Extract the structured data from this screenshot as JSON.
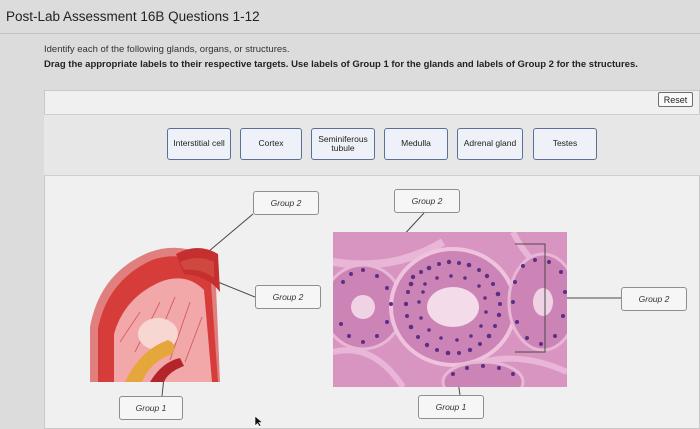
{
  "header": {
    "title": "Post-Lab Assessment 16B Questions 1-12"
  },
  "instructions": {
    "line1": "Identify each of the following glands, organs, or structures.",
    "line2": "Drag the appropriate labels to their respective targets. Use labels of Group 1 for the glands and labels of Group 2 for the structures."
  },
  "toolbar": {
    "reset_label": "Reset"
  },
  "label_bank": [
    {
      "id": "interstitial-cell",
      "label": "Interstitial cell"
    },
    {
      "id": "cortex",
      "label": "Cortex"
    },
    {
      "id": "seminiferous-tubule",
      "label": "Seminiferous tubule"
    },
    {
      "id": "medulla",
      "label": "Medulla"
    },
    {
      "id": "adrenal-gland",
      "label": "Adrenal gland"
    },
    {
      "id": "testes",
      "label": "Testes"
    }
  ],
  "targets": {
    "adrenal_upper": "Group 2",
    "adrenal_middle": "Group 2",
    "adrenal_bottom": "Group 1",
    "testis_upper": "Group 2",
    "testis_right": "Group 2",
    "testis_bottom": "Group 1"
  },
  "colors": {
    "chip_border": "#5b6f9a",
    "chip_fill": "#eef2f8",
    "cortex_red": "#d63d3a",
    "medulla_pink": "#f2a8a8",
    "histology_pink": "#d895c2",
    "nuclei_purple": "#5b2f84"
  },
  "icons": {
    "cursor": "mouse-pointer-icon"
  }
}
